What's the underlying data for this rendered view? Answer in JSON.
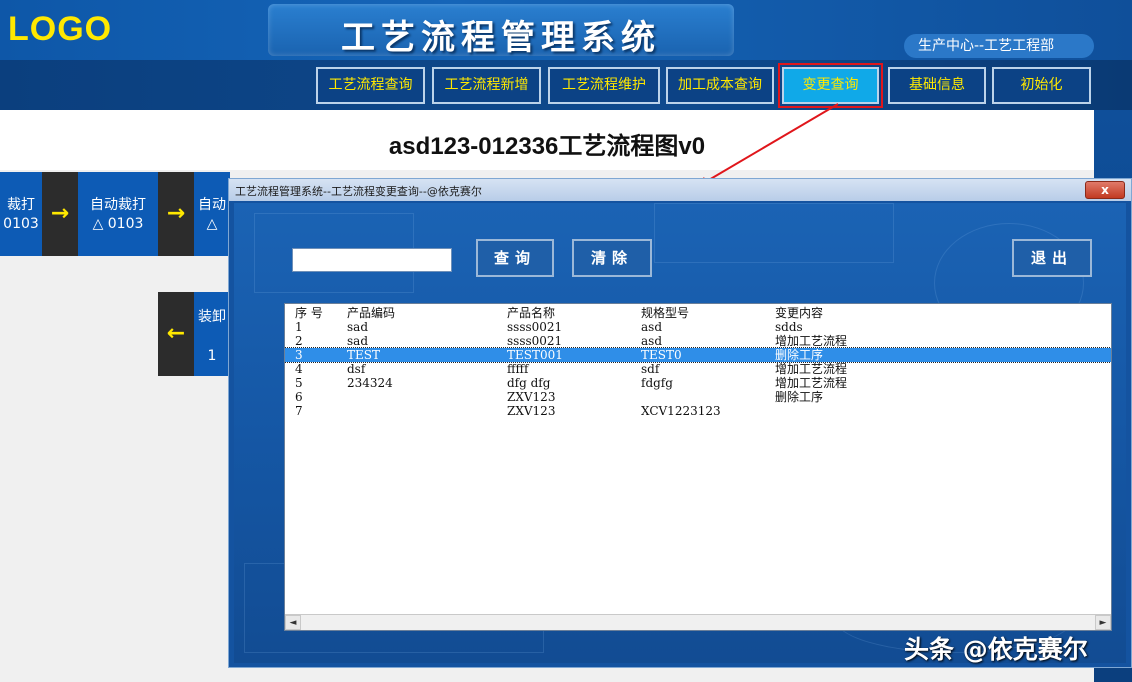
{
  "header": {
    "logo": "LOGO",
    "app_title": "工艺流程管理系统",
    "department": "生产中心--工艺工程部"
  },
  "nav": {
    "items": [
      {
        "label": "工艺流程查询"
      },
      {
        "label": "工艺流程新增"
      },
      {
        "label": "工艺流程维护"
      },
      {
        "label": "加工成本查询"
      },
      {
        "label": "变更查询"
      },
      {
        "label": "基础信息"
      },
      {
        "label": "初始化"
      }
    ],
    "active": "变更查询"
  },
  "chart": {
    "title": "asd123-012336工艺流程图v0"
  },
  "process": {
    "box1": {
      "line1": "裁打",
      "line2": "0103"
    },
    "box2": {
      "line1": "自动裁打",
      "line2": "△ 0103"
    },
    "box3": {
      "line1": "自动",
      "line2": "△"
    },
    "box4": {
      "line1": "装卸",
      "line2": "1"
    },
    "arrow_right": "→",
    "arrow_left": "←"
  },
  "dialog": {
    "title": "工艺流程管理系统--工艺流程变更查询--@依克赛尔",
    "close": "x",
    "search_value": "",
    "buttons": {
      "query": "查询",
      "clear": "清除",
      "exit": "退出"
    },
    "columns": [
      "序 号",
      "产品编码",
      "产品名称",
      "规格型号",
      "变更内容"
    ],
    "rows": [
      [
        "1",
        "sad",
        "ssss0021",
        "asd",
        "sdds"
      ],
      [
        "2",
        "sad",
        "ssss0021",
        "asd",
        "增加工艺流程"
      ],
      [
        "3",
        "TEST",
        "TEST001",
        "TEST0",
        "删除工序"
      ],
      [
        "4",
        "dsf",
        "fffff",
        "sdf",
        "增加工艺流程"
      ],
      [
        "5",
        "234324",
        "dfg dfg",
        "fdgfg",
        "增加工艺流程"
      ],
      [
        "6",
        "",
        "ZXV123",
        "",
        "删除工序"
      ],
      [
        "7",
        "",
        "ZXV123",
        "XCV1223123",
        ""
      ]
    ],
    "selected_row": 3,
    "scroll_left": "◄",
    "scroll_right": "►"
  },
  "watermark": "头条 @依克赛尔"
}
